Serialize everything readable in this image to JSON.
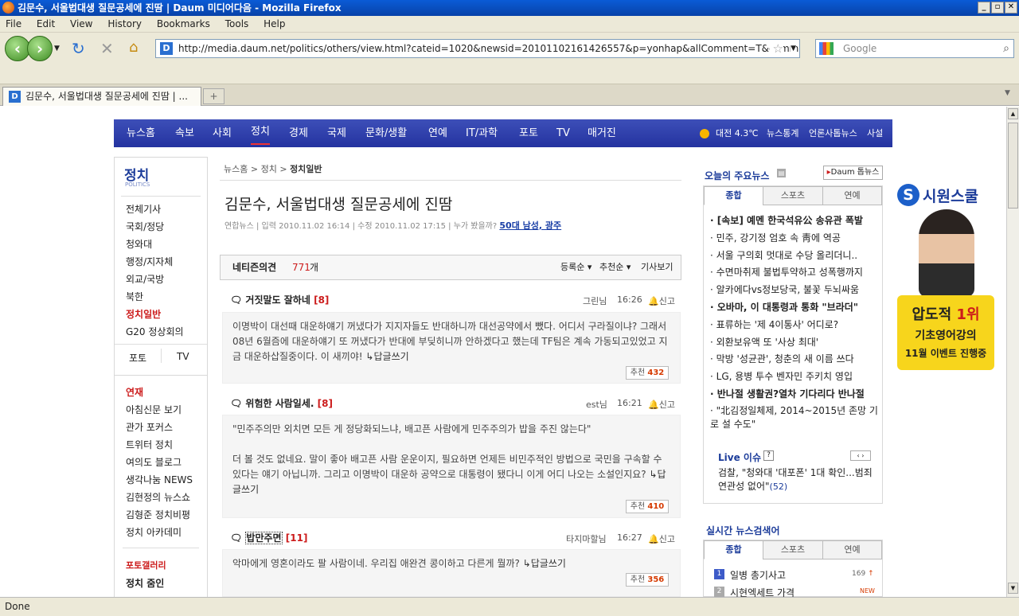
{
  "window": {
    "title": "김문수, 서울법대생 질문공세에 진땀 | Daum 미디어다음 - Mozilla Firefox"
  },
  "menu": [
    "File",
    "Edit",
    "View",
    "History",
    "Bookmarks",
    "Tools",
    "Help"
  ],
  "address": {
    "url": "http://media.daum.net/politics/others/view.html?cateid=1020&newsid=20101102161426557&p=yonhap&allComment=T&commentViewOption=true&cSortK",
    "search_placeholder": "Google"
  },
  "tab": {
    "title": "김문수, 서울법대생 질문공세에 진땀 | ..."
  },
  "status": "Done",
  "topnav": {
    "items": [
      "뉴스홈",
      "속보",
      "사회",
      "정치",
      "경제",
      "국제",
      "문화/생활",
      "연예",
      "IT/과학",
      "포토",
      "TV",
      "매거진"
    ],
    "weather": "대전 4.3℃",
    "links": [
      "뉴스통계",
      "언론사톱뉴스",
      "사설"
    ]
  },
  "left": {
    "section_title": "정치",
    "section_sub": "POLITICS",
    "items": [
      "전체기사",
      "국회/정당",
      "청와대",
      "행정/지자체",
      "외교/국방",
      "북한",
      "정치일반",
      "G20 정상회의"
    ],
    "photo": "포토",
    "tv": "TV",
    "series_title": "연재",
    "series": [
      "아침신문 보기",
      "관가 포커스",
      "트위터 정치",
      "여의도 블로그",
      "생각나눔 NEWS",
      "김현정의 뉴스쇼",
      "김형준 정치비평",
      "정치 아카데미"
    ],
    "gallery": "포토갤러리",
    "zoomin": "정치 줌인"
  },
  "article": {
    "breadcrumb": [
      "뉴스홈",
      "정치",
      "정치일반"
    ],
    "headline": "김문수, 서울법대생 질문공세에 진땀",
    "source": "연합뉴스",
    "input": "입력 2010.11.02 16:14",
    "edit": "수정 2010.11.02 17:15",
    "who_saw": "누가 봤을까?",
    "who_saw_link": "50대 남성, 광주"
  },
  "comments_bar": {
    "label": "네티즌의견",
    "count": "771",
    "unit": "개",
    "sort1": "등록순",
    "sort2": "추천순",
    "view_article": "기사보기"
  },
  "comments": [
    {
      "title": "거짓말도 잘하네",
      "replies": "[8]",
      "user": "그린님",
      "time": "16:26",
      "report": "신고",
      "body": "이명박이 대선때 대운하얘기 꺼냈다가 지지자들도 반대하니까 대선공약에서 뺐다. 어디서 구라질이냐? 그래서 08년 6월즘에 대운하얘기 또 꺼냈다가 반대에 부딪히니까 안하겠다고 했는데 TF팀은 계속 가동되고있었고 지금 대운하삽질중이다. 이 새끼야!",
      "reply": "답글쓰기",
      "rec_label": "추천",
      "rec": "432"
    },
    {
      "title": "위험한 사람일세.",
      "replies": "[8]",
      "user": "est님",
      "time": "16:21",
      "report": "신고",
      "body1": "\"민주주의만 외치면 모든 게 정당화되느냐, 배고픈 사람에게 민주주의가 밥을 주진 않는다\"",
      "body": "더 볼 것도 없네요. 말이 좋아 배고픈 사람 운운이지, 필요하면 언제든 비민주적인 방법으로 국민을 구속할 수 있다는 얘기 아닙니까. 그리고 이명박이 대운하 공약으로 대통령이 됐다니 이게 어디 나오는 소설인지요?",
      "reply": "답글쓰기",
      "rec_label": "추천",
      "rec": "410"
    },
    {
      "title": "밥만주면",
      "replies": "[11]",
      "user": "타지마할님",
      "time": "16:27",
      "report": "신고",
      "body": "악마에게 영혼이라도 팔 사람이네. 우리집 애완견 콩이하고 다른게 뭘까?",
      "reply": "답글쓰기",
      "rec_label": "추천",
      "rec": "356"
    }
  ],
  "right": {
    "title": "오늘의 주요뉴스",
    "daum_btn": "Daum 톱뉴스",
    "tabs": [
      "종합",
      "스포츠",
      "연예"
    ],
    "news": [
      {
        "t": "[속보] 예멘 한국석유公 송유관 폭발",
        "bold": true
      },
      {
        "t": "민주, 강기정 엄호 속 靑에 역공",
        "bold": false
      },
      {
        "t": "서울 구의회 멋대로 수당 올리더니..",
        "bold": false
      },
      {
        "t": "수면마취제 불법투약하고 성폭행까지",
        "bold": false
      },
      {
        "t": "알카에다vs정보당국, 불꽃 두뇌싸움",
        "bold": false
      },
      {
        "t": "오바마, 이 대통령과 통화 \"브라더\"",
        "bold": true
      },
      {
        "t": "표류하는 '제 4이통사' 어디로?",
        "bold": false
      },
      {
        "t": "외환보유액 또 '사상 최대'",
        "bold": false
      },
      {
        "t": "막방 '성균관', 청춘의 새 이름 쓰다",
        "bold": false
      },
      {
        "t": "LG, 용병 투수 벤자민 주키치 영입",
        "bold": false
      },
      {
        "t": "반나절 생활권?열차 기다리다 반나절",
        "bold": true
      },
      {
        "t": "\"北김정일체제, 2014~2015년 존망 기로 설 수도\"",
        "bold": false
      }
    ],
    "live_title": "Live 이슈",
    "live_text": "검찰, \"청와대 '대포폰' 1대 확인...범죄 연관성 없어\"",
    "live_count": "(52)",
    "realtime_title": "실시간 뉴스검색어",
    "realtime_tabs": [
      "종합",
      "스포츠",
      "연예"
    ],
    "rank": [
      {
        "n": "1",
        "t": "일병 총기사고",
        "v": "169"
      },
      {
        "n": "2",
        "t": "시현엑세트 가격",
        "v": "NEW"
      }
    ]
  },
  "ad": {
    "brand": "시원스쿨",
    "line1a": "압도적 ",
    "line1b": "1위",
    "line2": "기초영어강의",
    "line3": "11월 이벤트 진행중"
  }
}
